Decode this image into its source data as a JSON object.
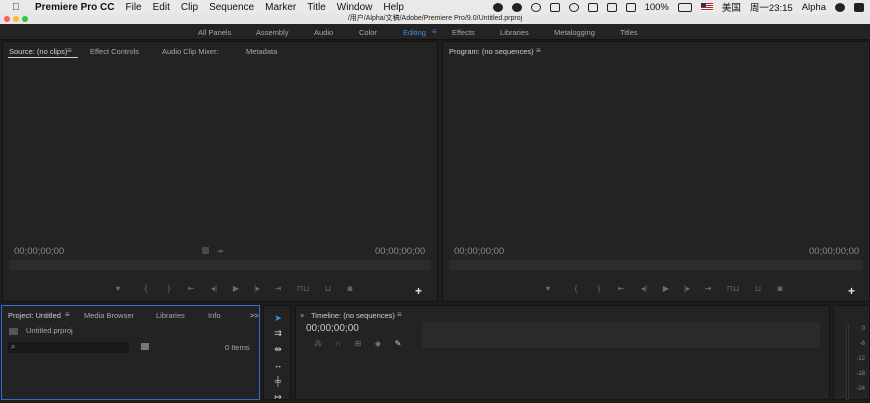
{
  "menubar": {
    "app_name": "Premiere Pro CC",
    "menus": [
      "File",
      "Edit",
      "Clip",
      "Sequence",
      "Marker",
      "Title",
      "Window",
      "Help"
    ],
    "battery": "100%",
    "input_language": "美国",
    "clock": "周一23:15",
    "user": "Alpha"
  },
  "titlebar": {
    "path": "/用户/Alpha/文稿/Adobe/Premiere Pro/9.0/Untitled.prproj"
  },
  "workspaces": {
    "items": [
      "All Panels",
      "Assembly",
      "Audio",
      "Color",
      "Editing",
      "Effects",
      "Libraries",
      "Metalogging",
      "Titles"
    ],
    "active": "Editing"
  },
  "source_panel": {
    "tabs": [
      "Source: (no clips)",
      "Effect Controls",
      "Audio Clip Mixer:",
      "Metadata"
    ],
    "timecode_left": "00;00;00;00",
    "timecode_right": "00;00;00;00"
  },
  "program_panel": {
    "tab": "Program: (no sequences)",
    "timecode_left": "00;00;00;00",
    "timecode_right": "00;00;00;00"
  },
  "project_panel": {
    "tabs": [
      "Project: Untitled",
      "Media Browser",
      "Libraries",
      "Info"
    ],
    "overflow": ">>",
    "file_name": "Untitled.prproj",
    "search_placeholder": "",
    "item_count": "0 Items"
  },
  "timeline_panel": {
    "close": "×",
    "tab": "Timeline: (no sequences)",
    "timecode": "00;00;00;00"
  },
  "audio_meter": {
    "labels": [
      "0",
      "-6",
      "-12",
      "-18",
      "-24"
    ]
  },
  "colors": {
    "accent": "#3c8fe6",
    "panel": "#232323",
    "background": "#1d1d1d"
  }
}
